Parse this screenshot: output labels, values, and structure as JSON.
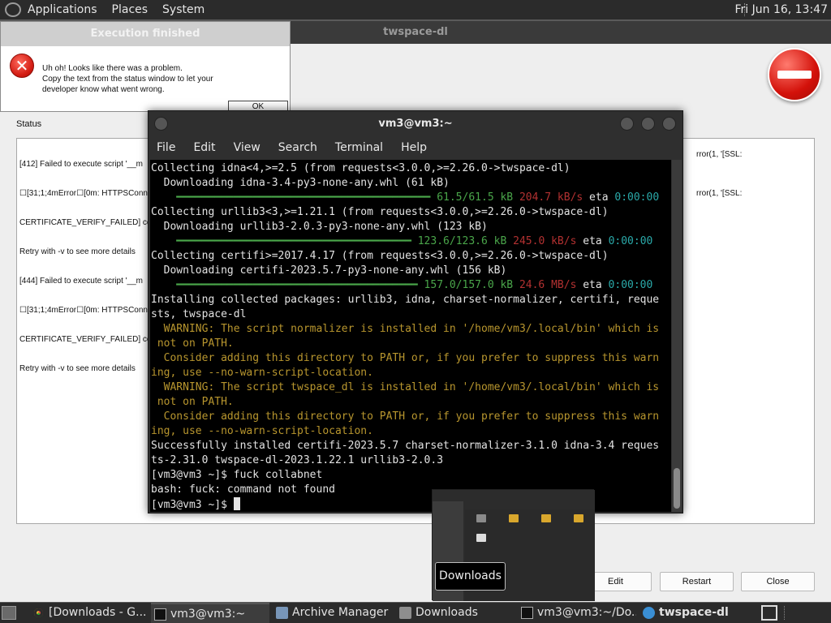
{
  "top_panel": {
    "menus": [
      "Applications",
      "Places",
      "System"
    ],
    "clock": "Fri Jun 16, 13:47"
  },
  "main_window": {
    "title": "twspace-dl",
    "status_label": "Status",
    "status_lines": [
      "[412] Failed to execute script '__m",
      "☐[31;1;4mError☐[0m: HTTPSConn",
      "CERTIFICATE_VERIFY_FAILED] certi",
      "Retry with -v to see more details",
      "[444] Failed to execute script '__m",
      "☐[31;1;4mError☐[0m: HTTPSConn",
      "CERTIFICATE_VERIFY_FAILED] certi",
      "Retry with -v to see more details"
    ],
    "status_right_1": "rror(1, '[SSL:",
    "status_right_2": "rror(1, '[SSL:",
    "buttons": {
      "edit": "Edit",
      "restart": "Restart",
      "close": "Close"
    }
  },
  "error_dialog": {
    "title": "Execution finished",
    "message": "Uh oh! Looks like there was a problem.\nCopy the text from the status window to let your\ndeveloper know what went wrong.",
    "ok": "OK"
  },
  "terminal": {
    "title": "vm3@vm3:~",
    "menu": [
      "File",
      "Edit",
      "View",
      "Search",
      "Terminal",
      "Help"
    ],
    "lines": [
      {
        "kind": "text",
        "text": "Collecting idna<4,>=2.5 (from requests<3.0.0,>=2.26.0->twspace-dl)"
      },
      {
        "kind": "text",
        "text": "  Downloading idna-3.4-py3-none-any.whl (61 kB)"
      },
      {
        "kind": "progress",
        "bar": "    ━━━━━━━━━━━━━━━━━━━━━━━━━━━━━━━━━━━━━━━━ ",
        "size": "61.5/61.5 kB",
        "speed": "204.7 kB/s",
        "eta_label": "eta",
        "eta": "0:00:00"
      },
      {
        "kind": "text",
        "text": "Collecting urllib3<3,>=1.21.1 (from requests<3.0.0,>=2.26.0->twspace-dl)"
      },
      {
        "kind": "text",
        "text": "  Downloading urllib3-2.0.3-py3-none-any.whl (123 kB)"
      },
      {
        "kind": "progress",
        "bar": "    ━━━━━━━━━━━━━━━━━━━━━━━━━━━━━━━━━━━━━ ",
        "size": "123.6/123.6 kB",
        "speed": "245.0 kB/s",
        "eta_label": "eta",
        "eta": "0:00:00"
      },
      {
        "kind": "text",
        "text": "Collecting certifi>=2017.4.17 (from requests<3.0.0,>=2.26.0->twspace-dl)"
      },
      {
        "kind": "text",
        "text": "  Downloading certifi-2023.5.7-py3-none-any.whl (156 kB)"
      },
      {
        "kind": "progress",
        "bar": "    ━━━━━━━━━━━━━━━━━━━━━━━━━━━━━━━━━━━━━━ ",
        "size": "157.0/157.0 kB",
        "speed": "24.6 MB/s",
        "eta_label": "eta",
        "eta": "0:00:00"
      },
      {
        "kind": "text",
        "text": "Installing collected packages: urllib3, idna, charset-normalizer, certifi, reque"
      },
      {
        "kind": "text",
        "text": "sts, twspace-dl"
      },
      {
        "kind": "warn",
        "text": "  WARNING: The script normalizer is installed in '/home/vm3/.local/bin' which is"
      },
      {
        "kind": "warn",
        "text": " not on PATH."
      },
      {
        "kind": "warn",
        "text": "  Consider adding this directory to PATH or, if you prefer to suppress this warn"
      },
      {
        "kind": "warn",
        "text": "ing, use --no-warn-script-location."
      },
      {
        "kind": "warn",
        "text": "  WARNING: The script twspace_dl is installed in '/home/vm3/.local/bin' which is"
      },
      {
        "kind": "warn",
        "text": " not on PATH."
      },
      {
        "kind": "warn",
        "text": "  Consider adding this directory to PATH or, if you prefer to suppress this warn"
      },
      {
        "kind": "warn",
        "text": "ing, use --no-warn-script-location."
      },
      {
        "kind": "text",
        "text": "Successfully installed certifi-2023.5.7 charset-normalizer-3.1.0 idna-3.4 reques"
      },
      {
        "kind": "text",
        "text": "ts-2.31.0 twspace-dl-2023.1.22.1 urllib3-2.0.3"
      },
      {
        "kind": "text",
        "text": "[vm3@vm3 ~]$ fuck collabnet"
      },
      {
        "kind": "text",
        "text": "bash: fuck: command not found"
      },
      {
        "kind": "prompt",
        "text": "[vm3@vm3 ~]$ "
      }
    ]
  },
  "preview": {
    "tooltip": "Downloads"
  },
  "taskbar": {
    "tasks": [
      {
        "label": "[Downloads - G...",
        "icon": "chrome-icon"
      },
      {
        "label": "vm3@vm3:~",
        "icon": "terminal-icon"
      },
      {
        "label": "Archive Manager",
        "icon": "archive-icon"
      },
      {
        "label": "Downloads",
        "icon": "folder-icon"
      },
      {
        "label": "vm3@vm3:~/Do...",
        "icon": "terminal-icon"
      },
      {
        "label": "twspace-dl",
        "icon": "twspace-icon"
      }
    ]
  },
  "colors": {
    "terminal_bg": "#000000",
    "progress_green": "#4aa64a",
    "speed_red": "#b33131",
    "eta_cyan": "#2aa9a9",
    "warning_yellow": "#b8962e",
    "error_red": "#d21b12"
  }
}
